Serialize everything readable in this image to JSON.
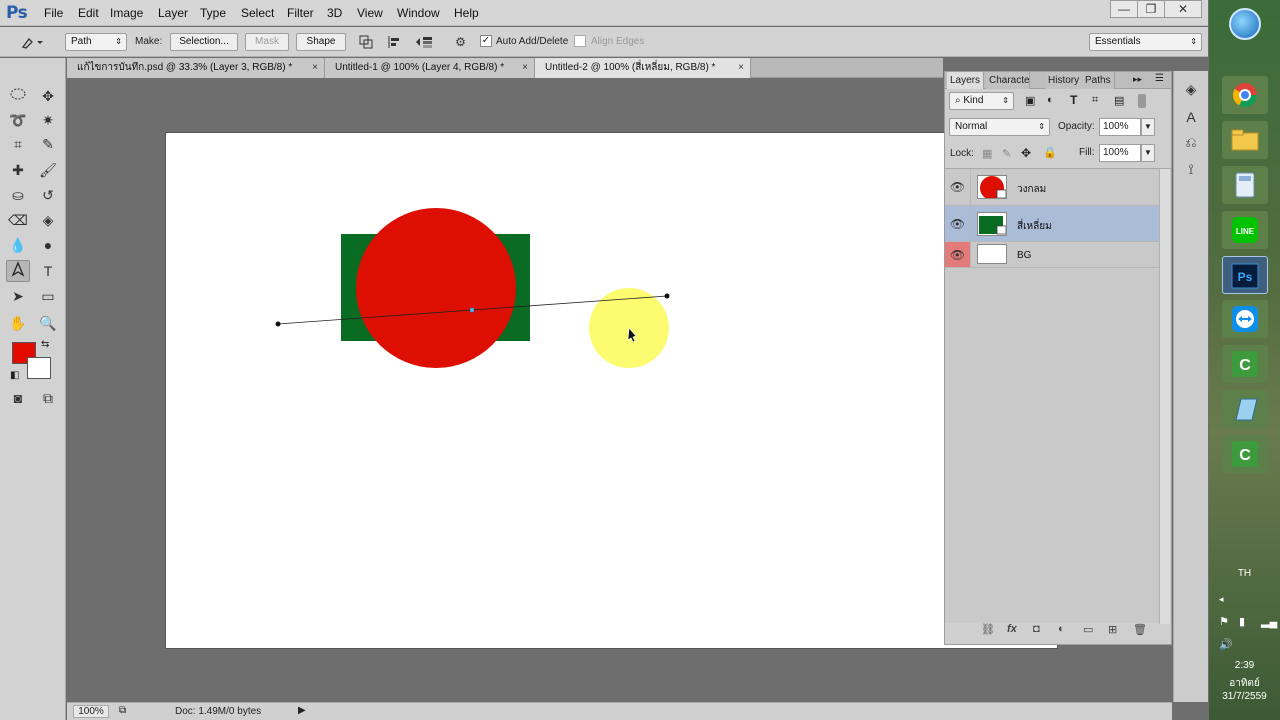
{
  "app": {
    "logo": "Ps",
    "menus": [
      "File",
      "Edit",
      "Image",
      "Layer",
      "Type",
      "Select",
      "Filter",
      "3D",
      "View",
      "Window",
      "Help"
    ],
    "window_controls": [
      "—",
      "❐",
      "✕"
    ]
  },
  "options_bar": {
    "tool_mode": "Path",
    "make_label": "Make:",
    "selection_button": "Selection...",
    "mask_button": "Mask",
    "shape_button": "Shape",
    "auto_add_delete_label": "Auto Add/Delete",
    "auto_add_delete_checked": true,
    "align_edges_label": "Align Edges",
    "align_edges_checked": false,
    "workspace": "Essentials"
  },
  "doc_tabs": [
    {
      "label": "แก้ไขการบันทึก.psd @ 33.3% (Layer 3, RGB/8) *",
      "active": false
    },
    {
      "label": "Untitled-1 @ 100% (Layer 4, RGB/8) *",
      "active": false
    },
    {
      "label": "Untitled-2 @ 100% (สี่เหลี่ยม, RGB/8) *",
      "active": true
    }
  ],
  "tab_close": "×",
  "canvas": {
    "background": "#ffffff",
    "rect_color": "#0a6b22",
    "circle_color": "#dd0e02",
    "cursor_highlight": "#fdfb60"
  },
  "tools": {
    "foreground_color": "#e30b00",
    "background_color": "#ffffff"
  },
  "layers_panel": {
    "tabs": [
      "Layers",
      "Characte",
      "History",
      "Paths"
    ],
    "filter_kind": "Kind",
    "blend_mode": "Normal",
    "opacity_label": "Opacity:",
    "opacity_value": "100%",
    "lock_label": "Lock:",
    "fill_label": "Fill:",
    "fill_value": "100%",
    "layers": [
      {
        "name": "วงกลม",
        "selected": false
      },
      {
        "name": "สี่เหลี่ยม",
        "selected": true
      },
      {
        "name": "BG",
        "selected": false
      }
    ]
  },
  "status_bar": {
    "zoom": "100%",
    "doc_info": "Doc: 1.49M/0 bytes"
  },
  "taskbar": {
    "language": "TH",
    "time": "2:39",
    "day": "อาทิตย์",
    "date": "31/7/2559",
    "app_icons": [
      "chrome",
      "file-explorer",
      "calculator",
      "line",
      "photoshop",
      "teamviewer",
      "camtasia",
      "notepad",
      "camtasia"
    ]
  }
}
